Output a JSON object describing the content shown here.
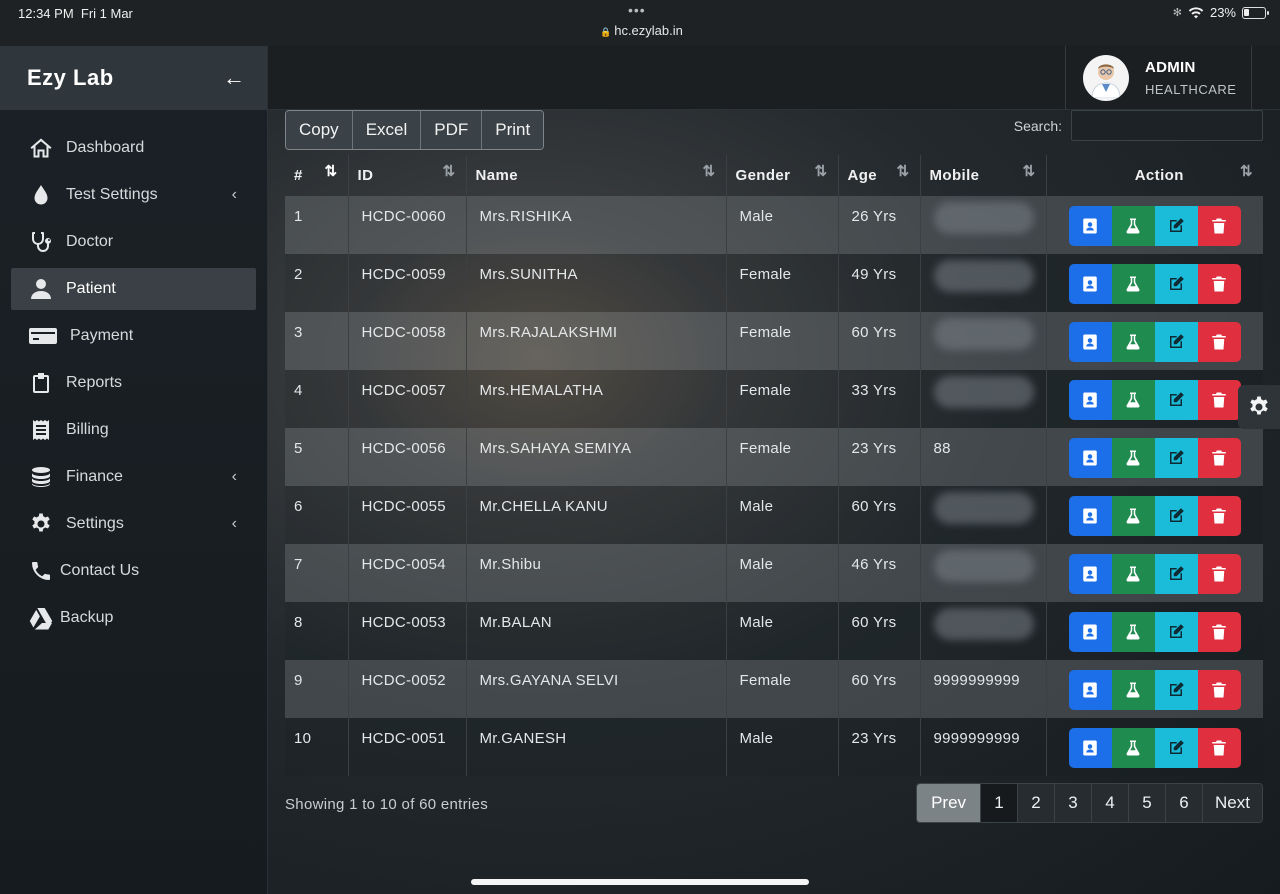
{
  "status_bar": {
    "time": "12:34 PM",
    "date": "Fri 1 Mar",
    "url": "hc.ezylab.in",
    "battery": "23%"
  },
  "sidebar": {
    "brand": "Ezy Lab",
    "items": [
      {
        "label": "Dashboard",
        "icon": "home-icon",
        "has_submenu": false
      },
      {
        "label": "Test Settings",
        "icon": "droplet-icon",
        "has_submenu": true
      },
      {
        "label": "Doctor",
        "icon": "stethoscope-icon",
        "has_submenu": false
      },
      {
        "label": "Patient",
        "icon": "user-icon",
        "has_submenu": false,
        "active": true
      },
      {
        "label": "Payment",
        "icon": "credit-card-icon",
        "has_submenu": false
      },
      {
        "label": "Reports",
        "icon": "clipboard-icon",
        "has_submenu": false
      },
      {
        "label": "Billing",
        "icon": "receipt-icon",
        "has_submenu": false
      },
      {
        "label": "Finance",
        "icon": "coins-icon",
        "has_submenu": true
      },
      {
        "label": "Settings",
        "icon": "gear-icon",
        "has_submenu": true
      },
      {
        "label": "Contact Us",
        "icon": "phone-icon",
        "has_submenu": false
      },
      {
        "label": "Backup",
        "icon": "drive-icon",
        "has_submenu": false
      }
    ]
  },
  "header": {
    "user_name": "ADMIN",
    "user_role": "HEALTHCARE"
  },
  "toolbar": {
    "copy": "Copy",
    "excel": "Excel",
    "pdf": "PDF",
    "print": "Print",
    "search_label": "Search:",
    "search_value": ""
  },
  "table": {
    "headers": [
      "#",
      "ID",
      "Name",
      "Gender",
      "Age",
      "Mobile",
      "Action"
    ],
    "rows": [
      {
        "n": "1",
        "id": "HCDC-0060",
        "name": "Mrs.RISHIKA",
        "gender": "Male",
        "age": "26 Yrs",
        "mobile": "",
        "mobile_hidden": true
      },
      {
        "n": "2",
        "id": "HCDC-0059",
        "name": "Mrs.SUNITHA",
        "gender": "Female",
        "age": "49 Yrs",
        "mobile": "",
        "mobile_hidden": true
      },
      {
        "n": "3",
        "id": "HCDC-0058",
        "name": "Mrs.RAJALAKSHMI",
        "gender": "Female",
        "age": "60 Yrs",
        "mobile": "",
        "mobile_hidden": true
      },
      {
        "n": "4",
        "id": "HCDC-0057",
        "name": "Mrs.HEMALATHA",
        "gender": "Female",
        "age": "33 Yrs",
        "mobile": "",
        "mobile_hidden": true
      },
      {
        "n": "5",
        "id": "HCDC-0056",
        "name": "Mrs.SAHAYA SEMIYA",
        "gender": "Female",
        "age": "23 Yrs",
        "mobile": "88",
        "mobile_hidden": false
      },
      {
        "n": "6",
        "id": "HCDC-0055",
        "name": "Mr.CHELLA KANU",
        "gender": "Male",
        "age": "60 Yrs",
        "mobile": "",
        "mobile_hidden": true
      },
      {
        "n": "7",
        "id": "HCDC-0054",
        "name": "Mr.Shibu",
        "gender": "Male",
        "age": "46 Yrs",
        "mobile": "",
        "mobile_hidden": true
      },
      {
        "n": "8",
        "id": "HCDC-0053",
        "name": "Mr.BALAN",
        "gender": "Male",
        "age": "60 Yrs",
        "mobile": "",
        "mobile_hidden": true
      },
      {
        "n": "9",
        "id": "HCDC-0052",
        "name": "Mrs.GAYANA SELVI",
        "gender": "Female",
        "age": "60 Yrs",
        "mobile": "9999999999",
        "mobile_hidden": false
      },
      {
        "n": "10",
        "id": "HCDC-0051",
        "name": "Mr.GANESH",
        "gender": "Male",
        "age": "23 Yrs",
        "mobile": "9999999999",
        "mobile_hidden": false
      }
    ],
    "row_actions": [
      "contact-card-icon",
      "flask-icon",
      "edit-icon",
      "trash-icon"
    ]
  },
  "footer": {
    "info": "Showing 1 to 10 of 60 entries",
    "prev": "Prev",
    "next": "Next",
    "pages": [
      "1",
      "2",
      "3",
      "4",
      "5",
      "6"
    ],
    "current_page": "1"
  },
  "colors": {
    "action_view": "#1c6fe8",
    "action_test": "#1f8b4f",
    "action_edit": "#1bbcd9",
    "action_delete": "#e0303f"
  }
}
